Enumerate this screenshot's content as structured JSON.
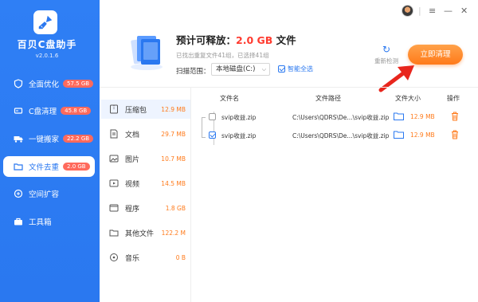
{
  "app": {
    "name": "百贝C盘助手",
    "version": "v2.0.1.6"
  },
  "sidebar": {
    "items": [
      {
        "label": "全面优化",
        "badge": "57.5 GB",
        "icon": "shield-icon"
      },
      {
        "label": "C盘清理",
        "badge": "45.8 GB",
        "icon": "disk-icon"
      },
      {
        "label": "一键搬家",
        "badge": "22.2 GB",
        "icon": "truck-icon"
      },
      {
        "label": "文件去重",
        "badge": "2.0 GB",
        "icon": "folder-icon",
        "active": true
      },
      {
        "label": "空间扩容",
        "badge": "",
        "icon": "expand-icon"
      },
      {
        "label": "工具箱",
        "badge": "",
        "icon": "toolbox-icon"
      }
    ]
  },
  "window": {
    "menu": "≡",
    "minimize": "—",
    "close": "✕"
  },
  "header": {
    "est_prefix": "预计可释放：",
    "est_size": "2.0 GB",
    "est_suffix": " 文件",
    "found": "已找出重复文件41组，已选择41组",
    "scan_label": "扫描范围：",
    "scan_value": "本地磁盘(C:)",
    "smart_select": "智能全选",
    "rescan": "重新检测",
    "clean_button": "立即清理"
  },
  "categories": [
    {
      "label": "压缩包",
      "size": "12.9 MB",
      "icon": "archive-icon",
      "active": true
    },
    {
      "label": "文档",
      "size": "29.7 MB",
      "icon": "document-icon"
    },
    {
      "label": "图片",
      "size": "10.7 MB",
      "icon": "image-icon"
    },
    {
      "label": "视频",
      "size": "14.5 MB",
      "icon": "video-icon"
    },
    {
      "label": "程序",
      "size": "1.8 GB",
      "icon": "program-icon"
    },
    {
      "label": "其他文件",
      "size": "122.2 M",
      "icon": "other-files-icon"
    },
    {
      "label": "音乐",
      "size": "0 B",
      "icon": "music-icon"
    }
  ],
  "table": {
    "headers": {
      "name": "文件名",
      "path": "文件路径",
      "size": "文件大小",
      "action": "操作"
    },
    "rows": [
      {
        "name": "svip收益.zip",
        "path": "C:\\Users\\QDRS\\De...\\svip收益.zip",
        "size": "12.9 MB",
        "checked": false
      },
      {
        "name": "svip收益.zip",
        "path": "C:\\Users\\QDRS\\De...\\svip收益.zip",
        "size": "12.9 MB",
        "checked": true
      }
    ]
  },
  "colors": {
    "sidebar": "#2a78f0",
    "accent_orange": "#ff7a1a",
    "badge": "#ff6a5c",
    "highlight_red": "#ff3b2f"
  }
}
